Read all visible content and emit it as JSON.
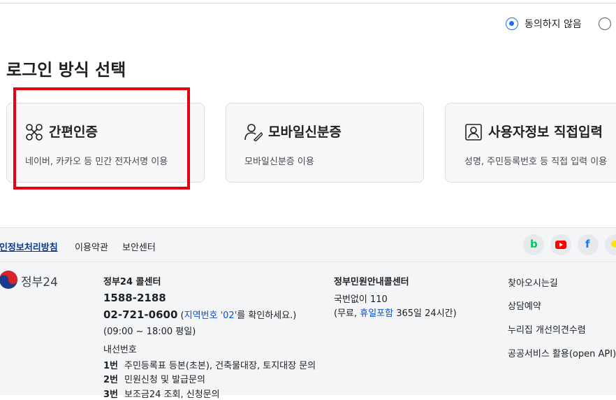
{
  "consent": {
    "disagree_label": "동의하지 않음",
    "disagree_checked": true
  },
  "login": {
    "section_title": "로그인 방식 선택",
    "methods": [
      {
        "title": "간편인증",
        "desc": "네이버, 카카오 등 민간 전자서명 이용",
        "icon": "simple-auth-icon"
      },
      {
        "title": "모바일신분증",
        "desc": "모바일신분증 이용",
        "icon": "mobile-id-icon"
      },
      {
        "title": "사용자정보 직접입력",
        "desc": "성명, 주민등록번호 등 직접 입력 이용",
        "icon": "user-info-icon"
      }
    ]
  },
  "footer": {
    "links": [
      "개인정보처리방침",
      "이용약관",
      "보안센터"
    ],
    "social": [
      {
        "icon": "blog-icon",
        "color": "#03c75a",
        "glyph": "b"
      },
      {
        "icon": "youtube-icon",
        "color": "#ff0000"
      },
      {
        "icon": "facebook-icon",
        "color": "#1877f2",
        "glyph": "f"
      },
      {
        "icon": "kakao-icon",
        "color": "#fee500"
      }
    ],
    "logo_text": "정부24",
    "callcenter": {
      "title": "정부24 콜센터",
      "phone1": "1588-2188",
      "phone2": "02-721-0600",
      "phone2_note_open": "(",
      "phone2_note_link": "지역번호 '02'",
      "phone2_note_rest": "를 확인하세요.)",
      "hours": "(09:00 ~ 18:00 평일)",
      "ext_title": "내선번호",
      "ext": [
        {
          "num": "1번",
          "text": "주민등록표 등본(초본), 건축물대장, 토지대장 문의"
        },
        {
          "num": "2번",
          "text": "민원신청 및 발급문의"
        },
        {
          "num": "3번",
          "text": "보조금24 조회, 신청문의"
        }
      ]
    },
    "gov_center": {
      "title": "정부민원안내콜센터",
      "line1": "국번없이 110",
      "line2_open": "(무료, ",
      "line2_link": "휴일포함",
      "line2_rest": " 365일 24시간)"
    },
    "side_links": [
      "찾아오시는길",
      "상담예약",
      "누리집 개선의견수렴",
      "공공서비스 활용(open API)"
    ]
  }
}
